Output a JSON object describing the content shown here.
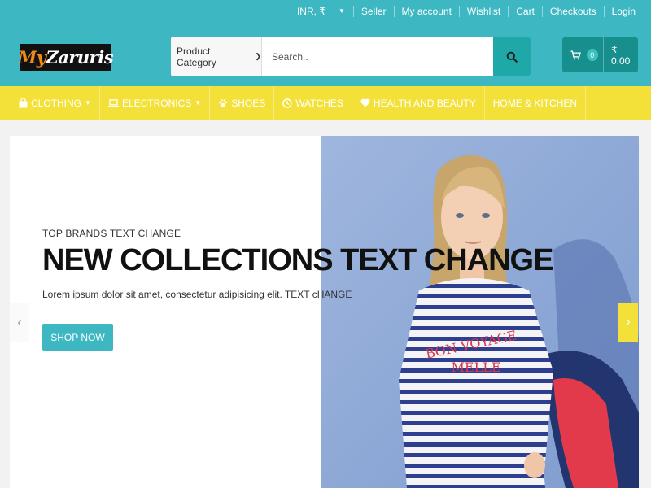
{
  "top_links": {
    "currency": "INR, ₹",
    "items": [
      "Seller",
      "My account",
      "Wishlist",
      "Cart",
      "Checkouts",
      "Login"
    ]
  },
  "logo": {
    "part1": "My",
    "part2": "Zaruris"
  },
  "search": {
    "category_value": "Product Category",
    "placeholder": "Search.."
  },
  "cart": {
    "count": "0",
    "amount": "₹ 0.00"
  },
  "nav": {
    "items": [
      {
        "label": "CLOTHING",
        "icon": "shopping-bag-icon"
      },
      {
        "label": "ELECTRONICS",
        "icon": "laptop-icon"
      },
      {
        "label": "SHOES",
        "icon": "paw-icon"
      },
      {
        "label": "WATCHES",
        "icon": "clock-icon"
      },
      {
        "label": "HEALTH AND BEAUTY",
        "icon": "heart-icon"
      },
      {
        "label": "HOME & KITCHEN"
      }
    ]
  },
  "hero": {
    "kicker": "TOP BRANDS TEXT CHANGE",
    "headline": "NEW COLLECTIONS TEXT CHANGE",
    "subtext": "Lorem ipsum dolor sit amet, consectetur adipisicing elit. TEXT cHANGE",
    "button": "SHOP NOW",
    "shirt_text_line1": "BON VOYAGE",
    "shirt_text_line2": "MELLE"
  },
  "colors": {
    "header": "#3db8c2",
    "nav": "#f3e13a",
    "search_button": "#1ea8a8",
    "cart_button": "#178f8c",
    "logo_accent": "#f08a1a"
  }
}
